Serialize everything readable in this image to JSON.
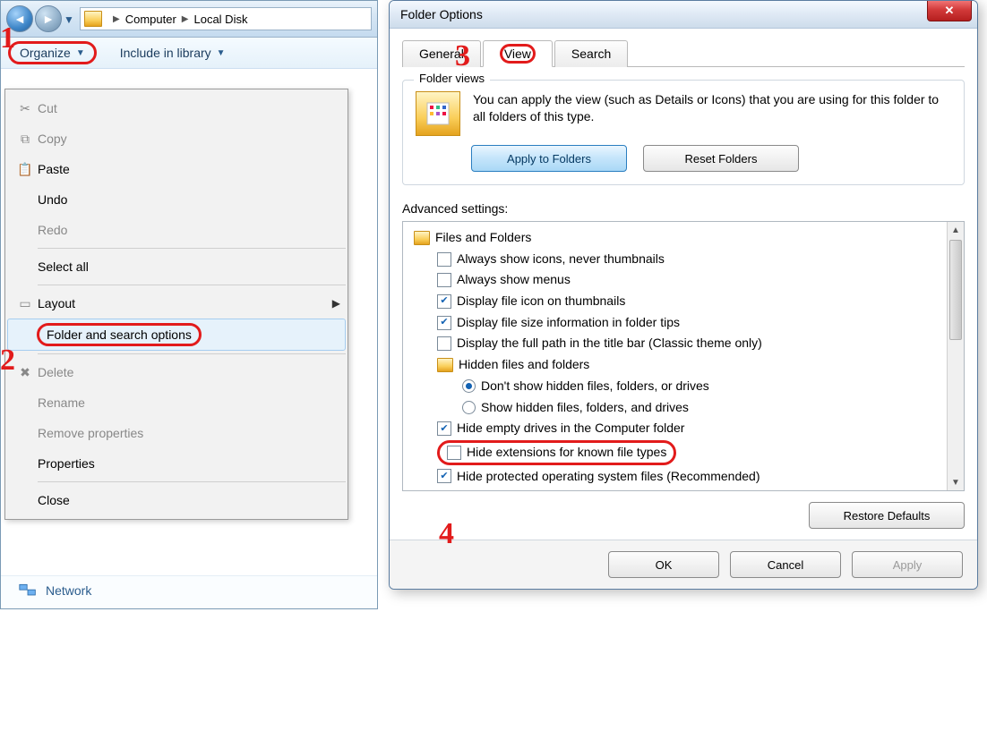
{
  "explorer": {
    "breadcrumb": {
      "seg1": "Computer",
      "seg2": "Local Disk"
    },
    "toolbar": {
      "organize": "Organize",
      "include": "Include in library"
    },
    "menu": {
      "cut": "Cut",
      "copy": "Copy",
      "paste": "Paste",
      "undo": "Undo",
      "redo": "Redo",
      "select_all": "Select all",
      "layout": "Layout",
      "folder_opts": "Folder and search options",
      "delete": "Delete",
      "rename": "Rename",
      "remove_props": "Remove properties",
      "properties": "Properties",
      "close": "Close"
    },
    "footer": {
      "network": "Network"
    }
  },
  "dialog": {
    "title": "Folder Options",
    "tabs": {
      "general": "General",
      "view": "View",
      "search": "Search"
    },
    "folder_views": {
      "legend": "Folder views",
      "text": "You can apply the view (such as Details or Icons) that you are using for this folder to all folders of this type.",
      "apply": "Apply to Folders",
      "reset": "Reset Folders"
    },
    "advanced_label": "Advanced settings:",
    "tree": {
      "root": "Files and Folders",
      "always_icons": "Always show icons, never thumbnails",
      "always_menus": "Always show menus",
      "display_icon": "Display file icon on thumbnails",
      "display_size": "Display file size information in folder tips",
      "display_path": "Display the full path in the title bar (Classic theme only)",
      "hidden_root": "Hidden files and folders",
      "hidden_dont": "Don't show hidden files, folders, or drives",
      "hidden_show": "Show hidden files, folders, and drives",
      "hide_empty": "Hide empty drives in the Computer folder",
      "hide_ext": "Hide extensions for known file types",
      "hide_prot": "Hide protected operating system files (Recommended)"
    },
    "restore": "Restore Defaults",
    "ok": "OK",
    "cancel": "Cancel",
    "apply": "Apply"
  },
  "annotations": {
    "one": "1",
    "two": "2",
    "three": "3",
    "four": "4"
  }
}
